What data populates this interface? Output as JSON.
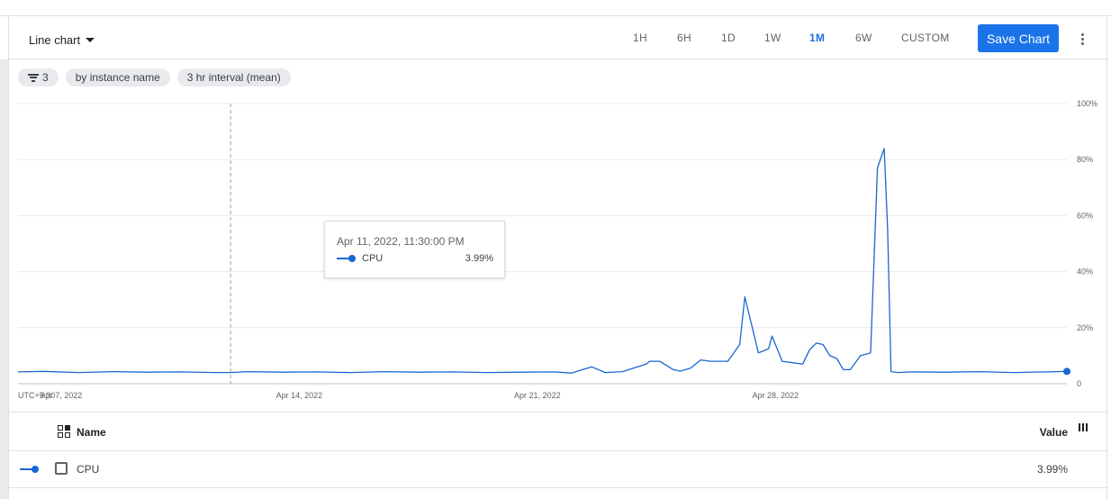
{
  "toolbar": {
    "chart_type_label": "Line chart",
    "ranges": [
      "1H",
      "6H",
      "1D",
      "1W",
      "1M",
      "6W",
      "CUSTOM"
    ],
    "active_range": "1M",
    "save_label": "Save Chart",
    "more_icon": "more-vert-icon"
  },
  "chips": {
    "filter_count": "3",
    "group_by": "by instance name",
    "interval": "3 hr interval (mean)"
  },
  "tooltip": {
    "time": "Apr 11, 2022, 11:30:00 PM",
    "series": "CPU",
    "value": "3.99%"
  },
  "table": {
    "name_header": "Name",
    "value_header": "Value",
    "rows": [
      {
        "name": "CPU",
        "value": "3.99%"
      }
    ]
  },
  "colors": {
    "accent": "#1a73e8",
    "series": "#1967d2"
  },
  "chart_data": {
    "type": "line",
    "timezone_label": "UTC+5:30",
    "x_tick_labels": [
      "Apr 7, 2022",
      "Apr 14, 2022",
      "Apr 21, 2022",
      "Apr 28, 2022"
    ],
    "y_tick_labels": [
      "0",
      "20%",
      "40%",
      "60%",
      "80%",
      "100%"
    ],
    "ylim": [
      0,
      100
    ],
    "xlim": [
      5.73,
      36.57
    ],
    "x_unit": "day of April 2022",
    "grid": true,
    "hover_x": 11.98,
    "series": [
      {
        "name": "CPU",
        "color": "#1967d2",
        "x": [
          5.73,
          6.5,
          7.5,
          8.5,
          9.5,
          10.5,
          11.5,
          11.98,
          12.5,
          13.5,
          14.5,
          15.5,
          16.5,
          17.5,
          18.5,
          19.5,
          20.5,
          21.5,
          22.0,
          22.6,
          23.0,
          23.5,
          24.2,
          24.3,
          24.6,
          25.0,
          25.2,
          25.5,
          25.8,
          26.1,
          26.6,
          26.95,
          27.1,
          27.5,
          27.8,
          27.9,
          28.2,
          28.5,
          28.8,
          29.0,
          29.2,
          29.4,
          29.6,
          29.8,
          30.0,
          30.2,
          30.5,
          30.8,
          31.0,
          31.2,
          31.3,
          31.4,
          31.6,
          32.0,
          33.0,
          34.0,
          35.0,
          36.0,
          36.57
        ],
        "y": [
          4.2,
          4.4,
          4.0,
          4.3,
          4.1,
          4.2,
          4.0,
          3.99,
          4.3,
          4.1,
          4.2,
          4.0,
          4.3,
          4.1,
          4.2,
          4.0,
          4.1,
          4.2,
          3.8,
          6.0,
          4.0,
          4.3,
          7.0,
          8.0,
          8.0,
          5.0,
          4.5,
          5.5,
          8.5,
          8.0,
          8.0,
          14.0,
          31.0,
          11.0,
          12.5,
          17.0,
          8.0,
          7.5,
          7.0,
          12.0,
          14.5,
          14.0,
          10.0,
          9.0,
          5.0,
          5.0,
          10.0,
          11.0,
          77.0,
          84.0,
          55.0,
          4.3,
          4.0,
          4.2,
          4.1,
          4.3,
          4.0,
          4.2,
          4.4
        ]
      }
    ]
  }
}
